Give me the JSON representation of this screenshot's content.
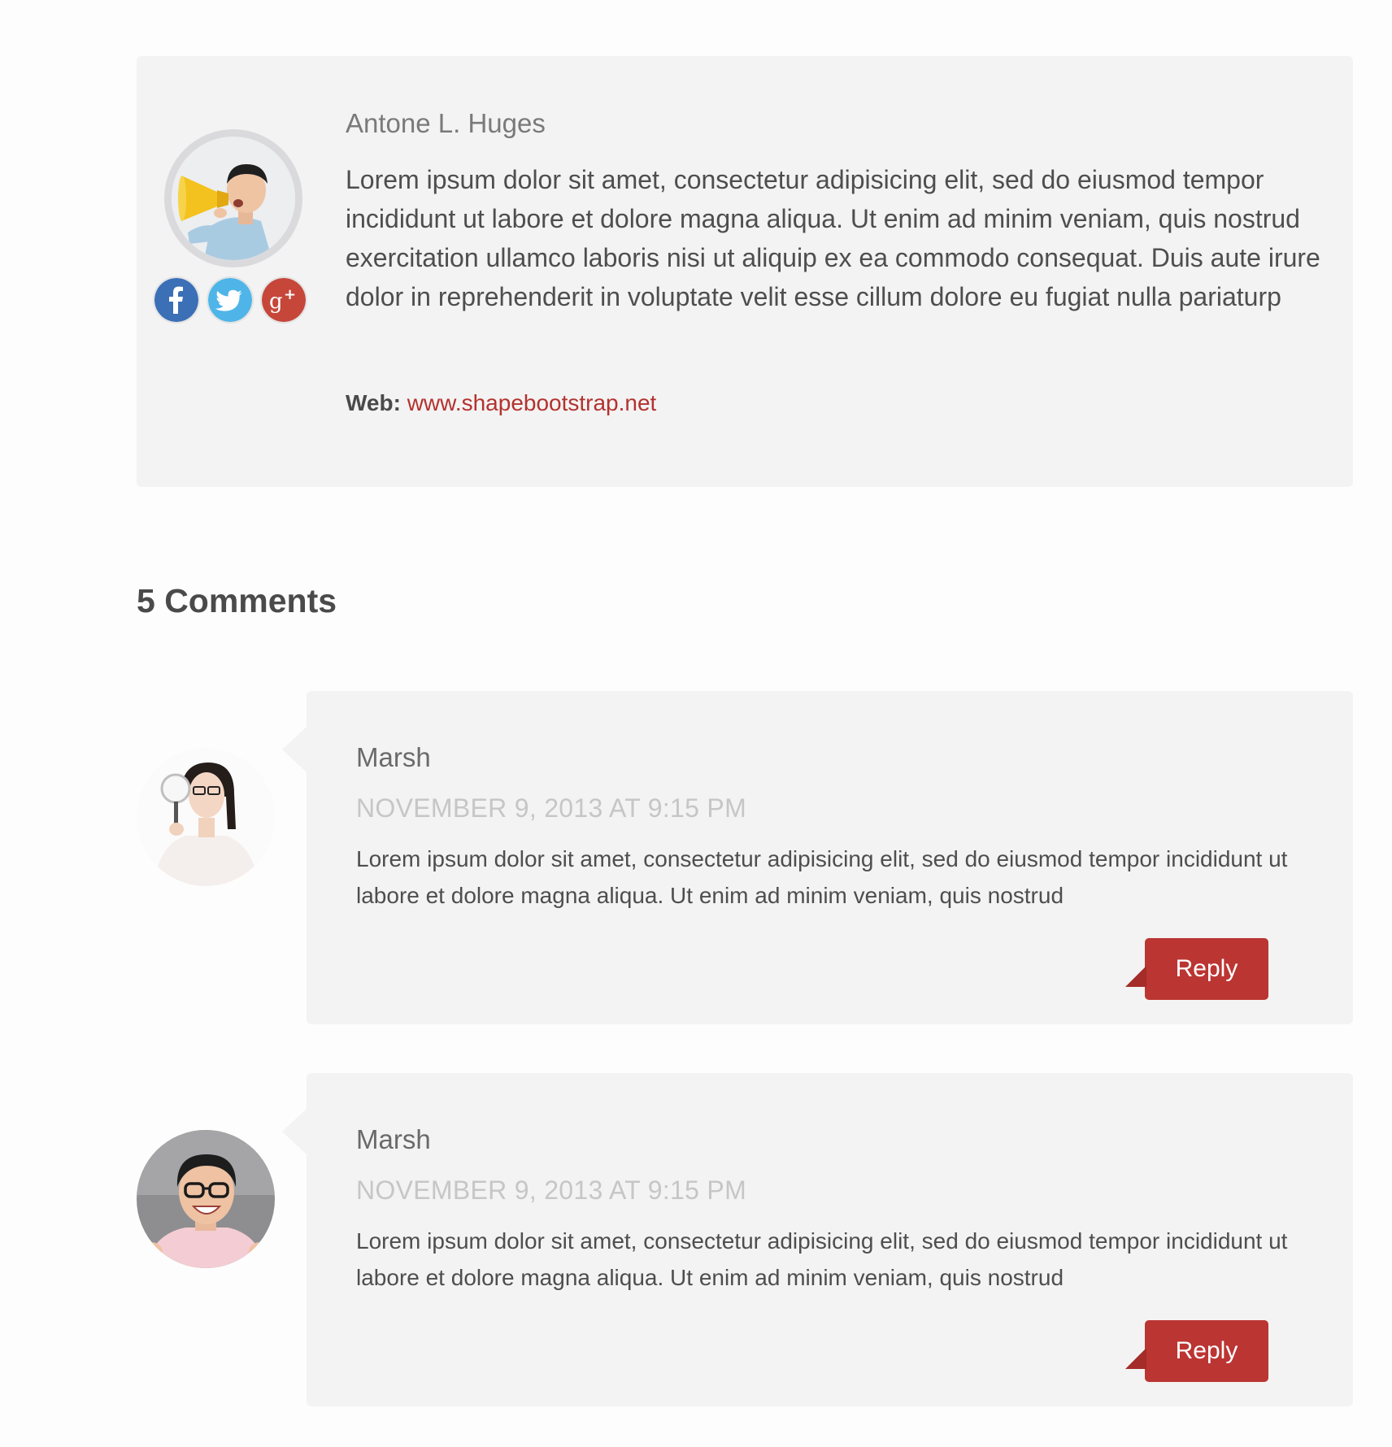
{
  "author": {
    "name": "Antone L. Huges",
    "bio": "Lorem ipsum dolor sit amet, consectetur adipisicing elit, sed do eiusmod tempor incididunt ut labore et dolore magna aliqua. Ut enim ad minim veniam, quis nostrud exercitation ullamco laboris nisi ut aliquip ex ea commodo consequat. Duis aute irure dolor in reprehenderit in voluptate velit esse cillum dolore eu fugiat nulla pariaturp",
    "web_label": "Web:",
    "web_url": "www.shapebootstrap.net",
    "social": [
      {
        "icon": "facebook-icon",
        "glyph": "f",
        "color": "#3b6fb6"
      },
      {
        "icon": "twitter-icon",
        "glyph": "t",
        "color": "#4fb5e8"
      },
      {
        "icon": "google-plus-icon",
        "glyph": "g+",
        "color": "#c6463a"
      }
    ]
  },
  "comments_heading": "5 Comments",
  "comments": [
    {
      "author": "Marsh",
      "date": "NOVEMBER 9, 2013 AT 9:15 PM",
      "text": "Lorem ipsum dolor sit amet, consectetur adipisicing elit, sed do eiusmod tempor incididunt ut labore et dolore magna aliqua. Ut enim ad minim veniam, quis nostrud",
      "reply_label": "Reply"
    },
    {
      "author": "Marsh",
      "date": "NOVEMBER 9, 2013 AT 9:15 PM",
      "text": "Lorem ipsum dolor sit amet, consectetur adipisicing elit, sed do eiusmod tempor incididunt ut labore et dolore magna aliqua. Ut enim ad minim veniam, quis nostrud",
      "reply_label": "Reply"
    }
  ],
  "colors": {
    "accent": "#bb3532",
    "link": "#b3322f",
    "panel": "#f3f3f3",
    "date": "#c6c6c6"
  }
}
